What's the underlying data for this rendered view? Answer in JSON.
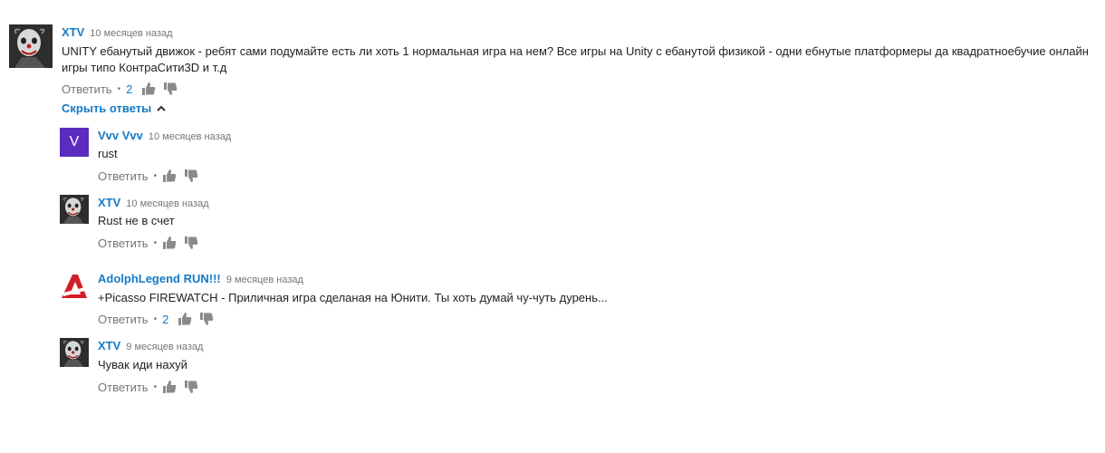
{
  "colors": {
    "author": "#167ac6",
    "meta": "#767676",
    "text": "#222222"
  },
  "top_comment": {
    "author": "XTV",
    "time": "10 месяцев назад",
    "text_line1": "UNITY ебанутый движок - ребят сами подумайте есть ли хоть 1 нормальная игра на нем? Все игры на Unity с ебанутой физикой - одни ебнутые платформеры да квадратноебучие онлайн",
    "text_line2": "игры типо КонтраСити3D и т.д",
    "reply_label": "Ответить",
    "likes": "2",
    "avatar_icon": "clown-avatar-icon"
  },
  "hide_replies_label": "Скрыть ответы",
  "replies": [
    {
      "author": "Vvv Vvv",
      "time": "10 месяцев назад",
      "text": "rust",
      "reply_label": "Ответить",
      "likes": "",
      "avatar_letter": "V"
    },
    {
      "author": "XTV",
      "time": "10 месяцев назад",
      "text": "Rust не в счет",
      "reply_label": "Ответить",
      "likes": "",
      "avatar_icon": "clown-avatar-icon"
    },
    {
      "author": "AdolphLegend RUN!!!",
      "time": "9 месяцев назад",
      "text": "+Picasso FIREWATCH  - Приличная игра сделаная на Юнити. Ты хоть думай чу-чуть дурень...",
      "reply_label": "Ответить",
      "likes": "2",
      "avatar_icon": "letter-a-avatar-icon"
    },
    {
      "author": "XTV",
      "time": "9 месяцев назад",
      "text": "Чувак иди нахуй",
      "reply_label": "Ответить",
      "likes": "",
      "avatar_icon": "clown-avatar-icon"
    }
  ]
}
